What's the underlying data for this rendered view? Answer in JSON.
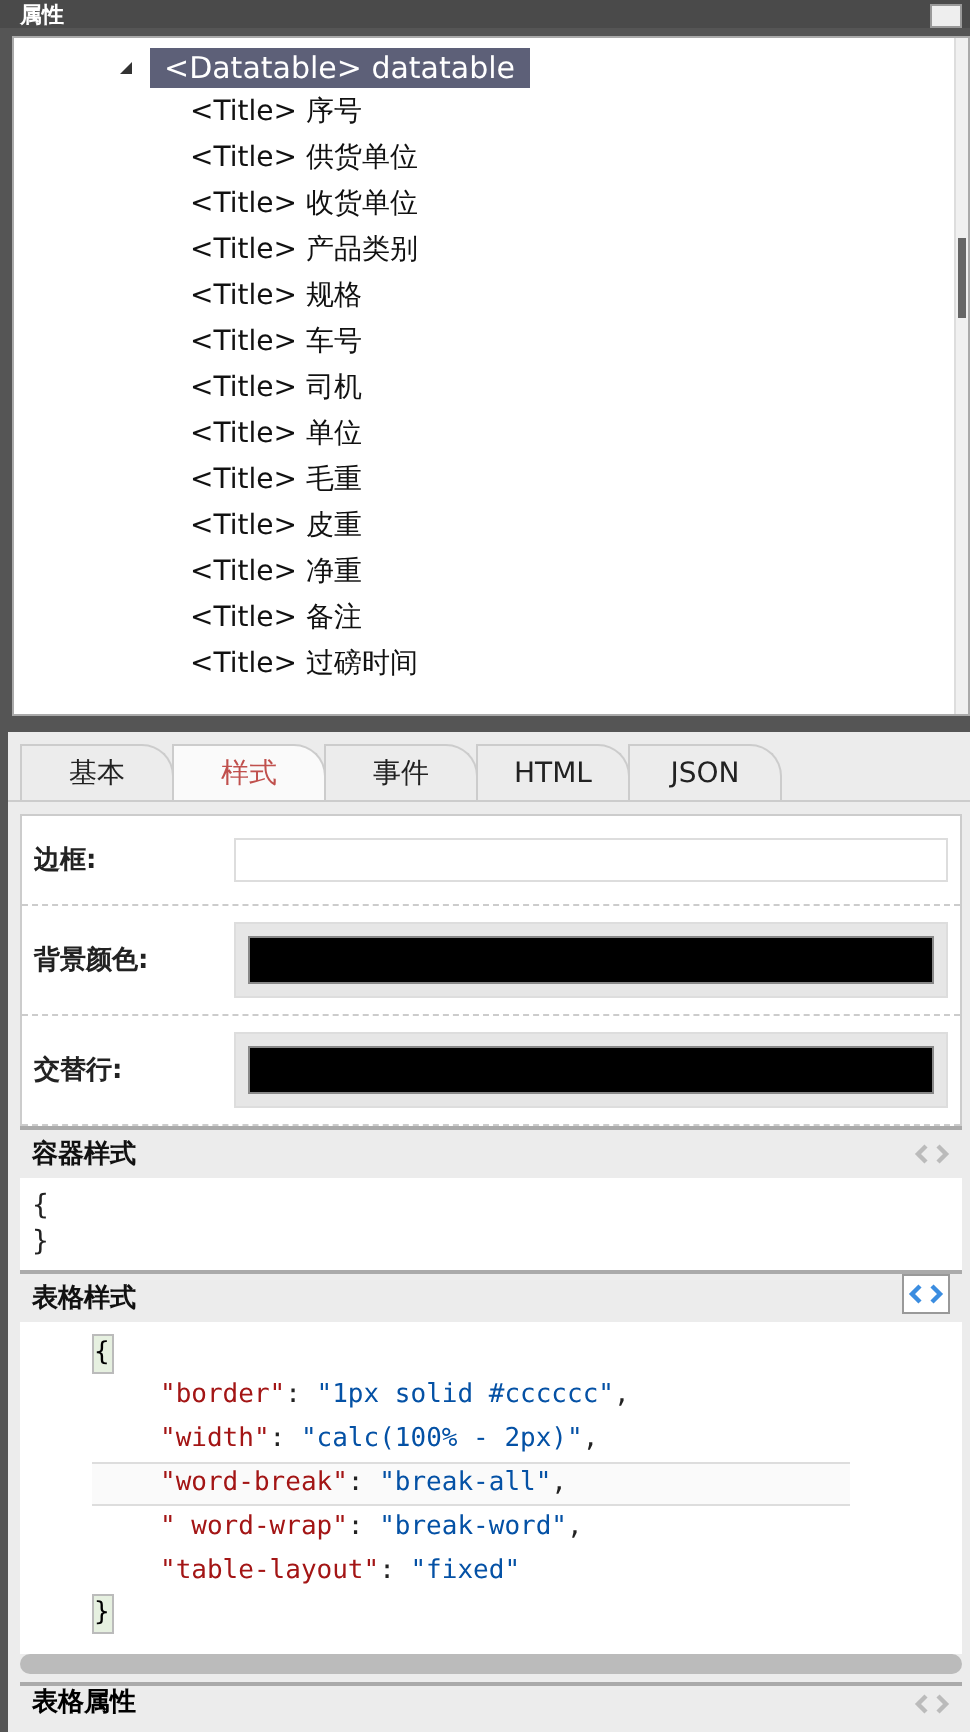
{
  "panel": {
    "title": "属性"
  },
  "tree": {
    "root": {
      "label": "<Datatable> datatable",
      "expanded": true,
      "selected": true,
      "children": [
        {
          "label": "<Title> 序号"
        },
        {
          "label": "<Title> 供货单位"
        },
        {
          "label": "<Title> 收货单位"
        },
        {
          "label": "<Title> 产品类别"
        },
        {
          "label": "<Title> 规格"
        },
        {
          "label": "<Title> 车号"
        },
        {
          "label": "<Title> 司机"
        },
        {
          "label": "<Title> 单位"
        },
        {
          "label": "<Title> 毛重"
        },
        {
          "label": "<Title> 皮重"
        },
        {
          "label": "<Title> 净重"
        },
        {
          "label": "<Title> 备注"
        },
        {
          "label": "<Title> 过磅时间"
        }
      ]
    }
  },
  "tabs": [
    {
      "label": "基本",
      "selected": false
    },
    {
      "label": "样式",
      "selected": true
    },
    {
      "label": "事件",
      "selected": false
    },
    {
      "label": "HTML",
      "selected": false
    },
    {
      "label": "JSON",
      "selected": false
    }
  ],
  "fields": [
    {
      "label": "边框:",
      "kind": "text"
    },
    {
      "label": "背景颜色:",
      "kind": "color",
      "color": "#000000"
    },
    {
      "label": "交替行:",
      "kind": "color",
      "color": "#000000"
    }
  ],
  "container_style": {
    "title": "容器样式",
    "active": false,
    "open": "{",
    "close": "}"
  },
  "table_style": {
    "title": "表格样式",
    "active": true,
    "open": "{",
    "close": "}",
    "lines": [
      {
        "key": "\"border\"",
        "sep": ": ",
        "value": "\"1px solid #cccccc\"",
        "end": ",",
        "active": false
      },
      {
        "key": "\"width\"",
        "sep": ": ",
        "value": "\"calc(100% - 2px)\"",
        "end": ",",
        "active": false
      },
      {
        "key": "\"word-break\"",
        "sep": ": ",
        "value": "\"break-all\"",
        "end": ",",
        "active": true
      },
      {
        "key": "\" word-wrap\"",
        "sep": ": ",
        "value": "\"break-word\"",
        "end": ",",
        "active": false
      },
      {
        "key": "\"table-layout\"",
        "sep": ": ",
        "value": "\"fixed\"",
        "active": false
      }
    ]
  },
  "table_props": {
    "title": "表格属性",
    "active": false
  }
}
